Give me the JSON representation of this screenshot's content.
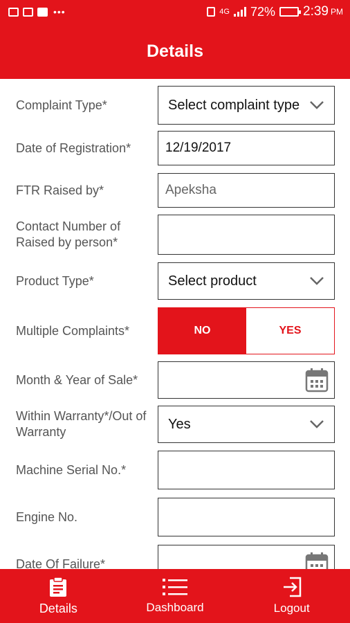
{
  "status_bar": {
    "network": "4G",
    "battery": "72%",
    "battery_level": 0.72,
    "time": "2:39",
    "ampm": "PM"
  },
  "header": {
    "title": "Details"
  },
  "form": {
    "complaint_type": {
      "label": "Complaint Type*",
      "value": "Select complaint type"
    },
    "date_of_registration": {
      "label": "Date of Registration*",
      "value": "12/19/2017"
    },
    "ftr_raised_by": {
      "label": "FTR Raised by*",
      "value": "Apeksha"
    },
    "contact_number": {
      "label": "Contact Number of Raised by person*",
      "value": ""
    },
    "product_type": {
      "label": "Product Type*",
      "value": "Select product"
    },
    "multiple_complaints": {
      "label": "Multiple Complaints*",
      "no_label": "NO",
      "yes_label": "YES",
      "selected": "NO"
    },
    "month_year_sale": {
      "label": "Month & Year of Sale*",
      "value": ""
    },
    "warranty": {
      "label": "Within Warranty*/Out of Warranty",
      "value": "Yes"
    },
    "machine_serial": {
      "label": "Machine Serial No.*",
      "value": ""
    },
    "engine_no": {
      "label": "Engine No.",
      "value": ""
    },
    "date_of_failure": {
      "label": "Date Of Failure*",
      "value": ""
    }
  },
  "bottom_nav": {
    "items": [
      {
        "label": "Details",
        "icon": "clipboard-icon"
      },
      {
        "label": "Dashboard",
        "icon": "list-icon"
      },
      {
        "label": "Logout",
        "icon": "logout-icon"
      }
    ]
  },
  "colors": {
    "brand": "#e3141b",
    "label_text": "#555555",
    "border": "#333333"
  }
}
